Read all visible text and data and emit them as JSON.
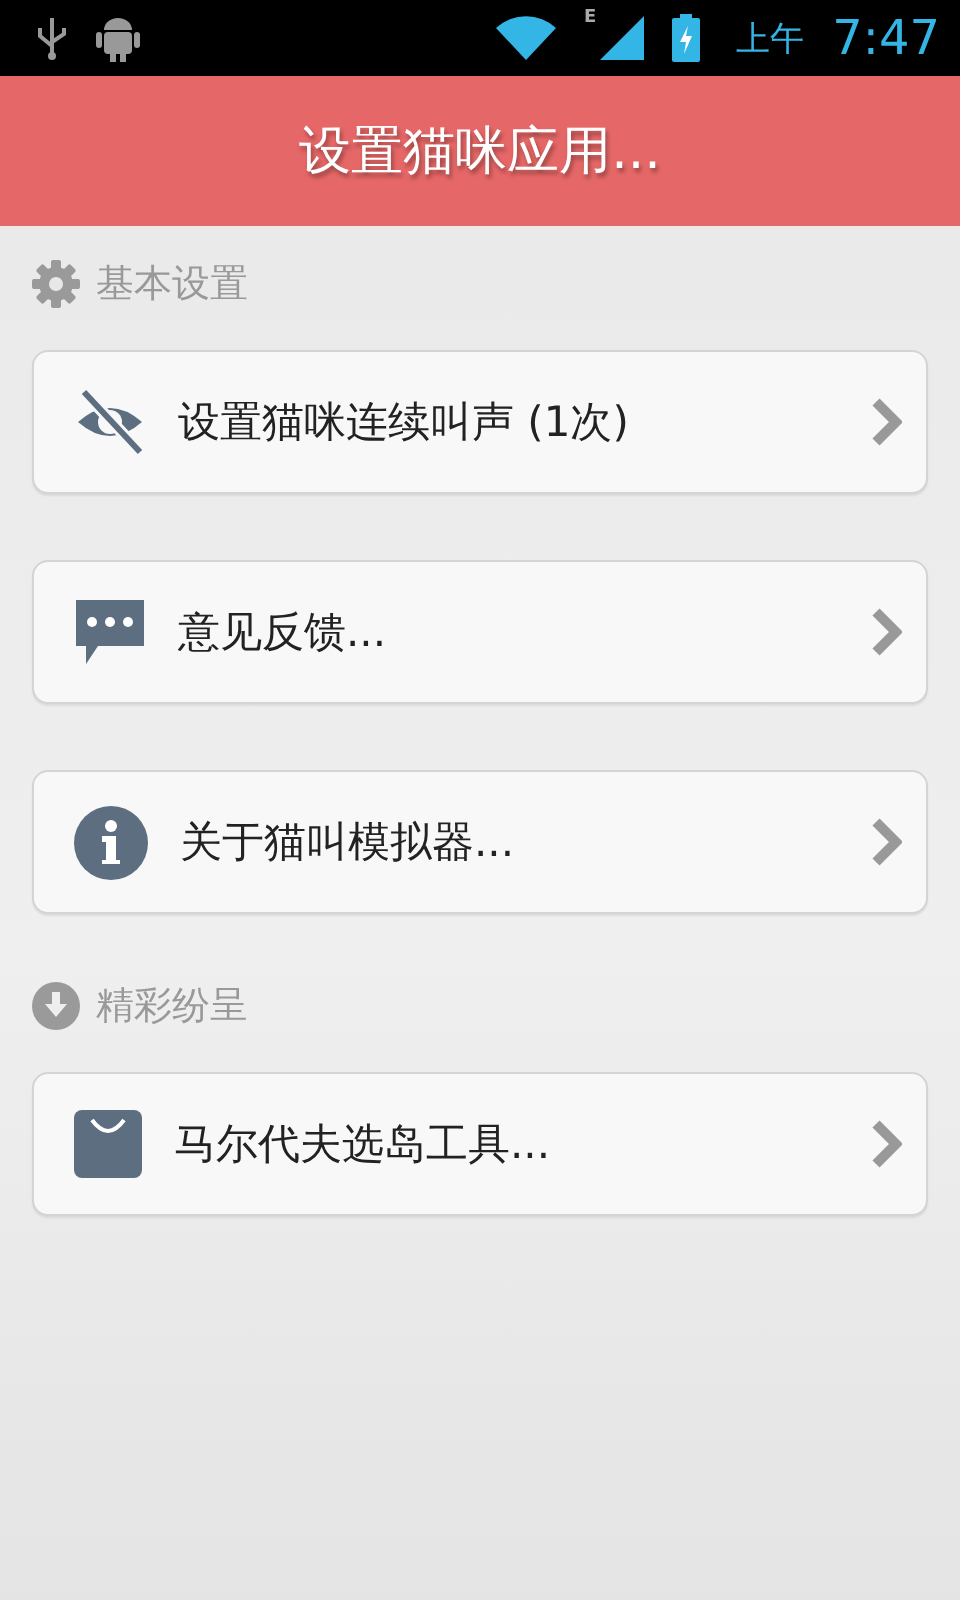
{
  "status_bar": {
    "period": "上午",
    "time": "7:47",
    "network_type": "E"
  },
  "header": {
    "title": "设置猫咪应用..."
  },
  "sections": [
    {
      "title": "基本设置",
      "kind": "settings",
      "items": [
        {
          "label": "设置猫咪连续叫声 (1次)",
          "kind": "hidden"
        },
        {
          "label": "意见反馈...",
          "kind": "feedback"
        },
        {
          "label": "关于猫叫模拟器...",
          "kind": "info"
        }
      ]
    },
    {
      "title": "精彩纷呈",
      "kind": "download",
      "items": [
        {
          "label": "马尔代夫选岛工具...",
          "kind": "bag"
        }
      ]
    }
  ]
}
